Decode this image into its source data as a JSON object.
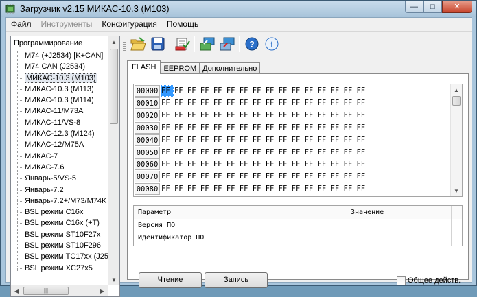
{
  "window": {
    "title": "Загрузчик v2.15 МИКАС-10.3 (M103)",
    "controls": {
      "minimize": "—",
      "maximize": "□",
      "close": "✕"
    }
  },
  "menu": {
    "items": [
      {
        "label": "Файл",
        "enabled": true
      },
      {
        "label": "Инструменты",
        "enabled": false
      },
      {
        "label": "Конфигурация",
        "enabled": true
      },
      {
        "label": "Помощь",
        "enabled": true
      }
    ]
  },
  "tree": {
    "root": "Программирование",
    "selected_index": 2,
    "items": [
      "M74 (+J2534) [K+CAN]",
      "M74 CAN (J2534)",
      "МИКАС-10.3 (M103)",
      "МИКАС-10.3 (M113)",
      "МИКАС-10.3 (M114)",
      "МИКАС-11/M73A",
      "МИКАС-11/VS-8",
      "МИКАС-12.3 (M124)",
      "МИКАС-12/M75A",
      "МИКАС-7",
      "МИКАС-7.6",
      "Январь-5/VS-5",
      "Январь-7.2",
      "Январь-7.2+/M73/M74K",
      "BSL режим C16x",
      "BSL режим C16x (+T)",
      "BSL режим ST10F27x",
      "BSL режим ST10F296",
      "BSL режим TC17xx (J25",
      "BSL режим XC27x5"
    ],
    "hscroll_grip": "|||"
  },
  "toolbar": {
    "buttons": [
      {
        "icon": "open-folder-icon",
        "tooltip": ""
      },
      {
        "icon": "save-disk-icon",
        "tooltip": ""
      },
      {
        "icon": "checklist-icon",
        "tooltip": ""
      },
      {
        "icon": "read-ecu-icon",
        "tooltip": ""
      },
      {
        "icon": "write-ecu-icon",
        "tooltip": ""
      },
      {
        "icon": "help-icon",
        "tooltip": ""
      },
      {
        "icon": "info-icon",
        "tooltip": ""
      }
    ]
  },
  "tabs": [
    {
      "label": "FLASH",
      "active": true
    },
    {
      "label": "EEPROM",
      "active": false
    },
    {
      "label": "Дополнительно",
      "active": false
    }
  ],
  "hex": {
    "rows": [
      {
        "addr": "00000",
        "bytes": "FF FF FF FF FF FF FF FF FF FF FF FF FF FF FF FF"
      },
      {
        "addr": "00010",
        "bytes": "FF FF FF FF FF FF FF FF FF FF FF FF FF FF FF FF"
      },
      {
        "addr": "00020",
        "bytes": "FF FF FF FF FF FF FF FF FF FF FF FF FF FF FF FF"
      },
      {
        "addr": "00030",
        "bytes": "FF FF FF FF FF FF FF FF FF FF FF FF FF FF FF FF"
      },
      {
        "addr": "00040",
        "bytes": "FF FF FF FF FF FF FF FF FF FF FF FF FF FF FF FF"
      },
      {
        "addr": "00050",
        "bytes": "FF FF FF FF FF FF FF FF FF FF FF FF FF FF FF FF"
      },
      {
        "addr": "00060",
        "bytes": "FF FF FF FF FF FF FF FF FF FF FF FF FF FF FF FF"
      },
      {
        "addr": "00070",
        "bytes": "FF FF FF FF FF FF FF FF FF FF FF FF FF FF FF FF"
      },
      {
        "addr": "00080",
        "bytes": "FF FF FF FF FF FF FF FF FF FF FF FF FF FF FF FF"
      }
    ],
    "selected_byte": "FF"
  },
  "params": {
    "headers": {
      "param": "Параметр",
      "value": "Значение"
    },
    "rows": [
      {
        "name": "Версия ПО",
        "value": ""
      },
      {
        "name": "Идентификатор ПО",
        "value": ""
      }
    ]
  },
  "actions": {
    "read_label": "Чтение",
    "write_label": "Запись",
    "checkbox_label": "Общее действ.",
    "checkbox_checked": false
  },
  "colors": {
    "selection": "#3399ff",
    "window_frame": "#a9c6dd",
    "close_button": "#c7442b"
  }
}
